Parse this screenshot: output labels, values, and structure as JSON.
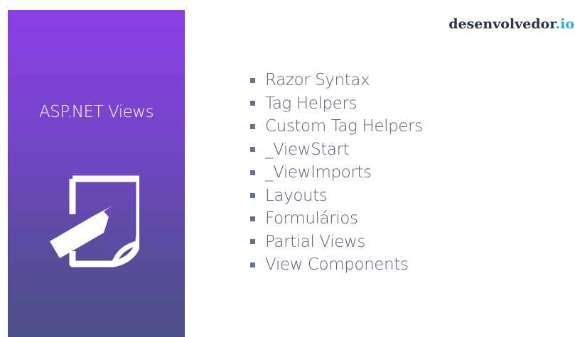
{
  "slide": {
    "panel_title": "ASP.NET Views",
    "panel_icon": "document-edit-icon",
    "brand": {
      "name": "desenvolvedor",
      "dot": ".",
      "suffix": "io"
    },
    "topics": [
      "Razor Syntax",
      "Tag Helpers",
      "Custom Tag Helpers",
      "_ViewStart",
      "_ViewImports",
      "Layouts",
      "Formulários",
      "Partial Views",
      "View Components"
    ]
  },
  "colors": {
    "panel_gradient_top": "#8a3fe6",
    "panel_gradient_bottom": "#4c4f86",
    "text": "#596176",
    "brand_text": "#2d3546",
    "brand_accent": "#2fa7e2"
  }
}
